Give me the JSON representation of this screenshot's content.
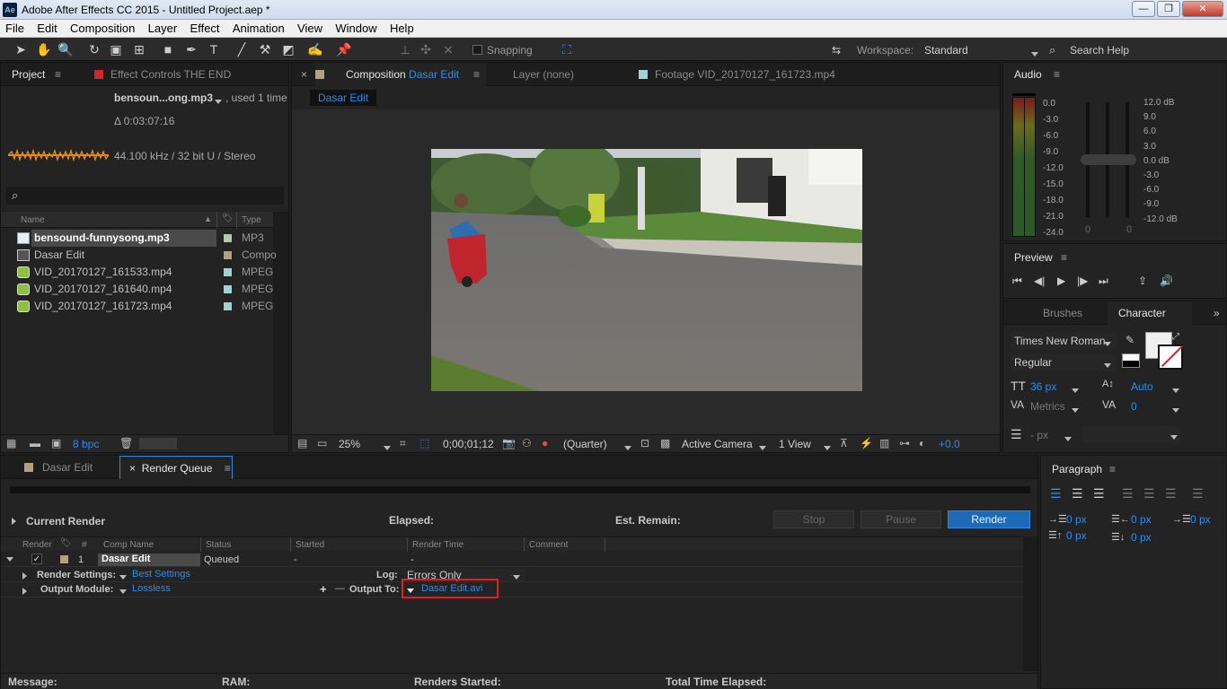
{
  "app": {
    "logo": "Ae",
    "title": "Adobe After Effects CC 2015 - Untitled Project.aep *",
    "minimize": "—",
    "maximize": "❐",
    "close": "✕"
  },
  "menu": [
    "File",
    "Edit",
    "Composition",
    "Layer",
    "Effect",
    "Animation",
    "View",
    "Window",
    "Help"
  ],
  "toolbar": {
    "snapping": "Snapping",
    "workspace_label": "Workspace:",
    "workspace_value": "Standard",
    "search_help": "Search Help"
  },
  "project": {
    "tab_project": "Project",
    "tab_effect_controls": "Effect Controls THE END",
    "file_name": "bensoun...ong.mp3",
    "used": ", used 1 time",
    "duration": "Δ 0:03:07:16",
    "audio_info": "44.100 kHz / 32 bit U / Stereo",
    "col_name": "Name",
    "col_type": "Type",
    "bpc": "8 bpc",
    "items": [
      {
        "name": "bensound-funnysong.mp3",
        "type": "MP3",
        "color": "#b4c8b0",
        "icon": "audio-file-icon",
        "selected": true
      },
      {
        "name": "Dasar Edit",
        "type": "Compo",
        "color": "#b3a082",
        "icon": "composition-icon",
        "selected": false
      },
      {
        "name": "VID_20170127_161533.mp4",
        "type": "MPEG",
        "color": "#9fd3d3",
        "icon": "footage-icon",
        "selected": false
      },
      {
        "name": "VID_20170127_161640.mp4",
        "type": "MPEG",
        "color": "#9fd3d3",
        "icon": "footage-icon",
        "selected": false
      },
      {
        "name": "VID_20170127_161723.mp4",
        "type": "MPEG",
        "color": "#9fd3d3",
        "icon": "footage-icon",
        "selected": false
      }
    ]
  },
  "viewer": {
    "tab_comp_prefix": "Composition",
    "tab_comp_name": "Dasar Edit",
    "tab_layer": "Layer (none)",
    "tab_footage": "Footage VID_20170127_161723.mp4",
    "breadcrumb": "Dasar Edit",
    "zoom": "25%",
    "timecode": "0;00;01;12",
    "resolution": "(Quarter)",
    "camera": "Active Camera",
    "views": "1 View",
    "exposure": "+0.0"
  },
  "audio": {
    "title": "Audio",
    "left_scale": [
      "0.0",
      "-3.0",
      "-6.0",
      "-9.0",
      "-12.0",
      "-15.0",
      "-18.0",
      "-21.0",
      "-24.0"
    ],
    "right_scale": [
      "12.0 dB",
      "9.0",
      "6.0",
      "3.0",
      "0.0 dB",
      "-3.0",
      "-6.0",
      "-9.0",
      "-12.0 dB"
    ],
    "slider_left": "0",
    "slider_right": "0"
  },
  "preview": {
    "title": "Preview"
  },
  "character": {
    "tab_brushes": "Brushes",
    "tab_character": "Character",
    "font": "Times New Roman",
    "style": "Regular",
    "size": "36 px",
    "leading": "Auto",
    "kerning": "Metrics",
    "tracking": "0",
    "stroke": "- px"
  },
  "paragraph": {
    "title": "Paragraph",
    "indent_left": "0 px",
    "indent_right": "0 px",
    "indent_first": "0 px",
    "space_before": "0 px",
    "space_after": "0 px"
  },
  "render_queue": {
    "tab_comp": "Dasar Edit",
    "tab_rq": "Render Queue",
    "current_render": "Current Render",
    "elapsed": "Elapsed:",
    "est_remain": "Est. Remain:",
    "stop": "Stop",
    "pause": "Pause",
    "render": "Render",
    "columns": {
      "render": "Render",
      "num": "#",
      "comp": "Comp Name",
      "status": "Status",
      "started": "Started",
      "render_time": "Render Time",
      "comment": "Comment"
    },
    "item": {
      "num": "1",
      "comp": "Dasar Edit",
      "status": "Queued",
      "started": "-",
      "render_time": "-"
    },
    "render_settings_label": "Render Settings:",
    "render_settings_value": "Best Settings",
    "log_label": "Log:",
    "log_value": "Errors Only",
    "output_module_label": "Output Module:",
    "output_module_value": "Lossless",
    "output_to_label": "Output To:",
    "output_to_value": "Dasar Edit.avi",
    "plus": "+",
    "minus": "—"
  },
  "status": {
    "message": "Message:",
    "ram": "RAM:",
    "renders_started": "Renders Started:",
    "total_time": "Total Time Elapsed:"
  }
}
